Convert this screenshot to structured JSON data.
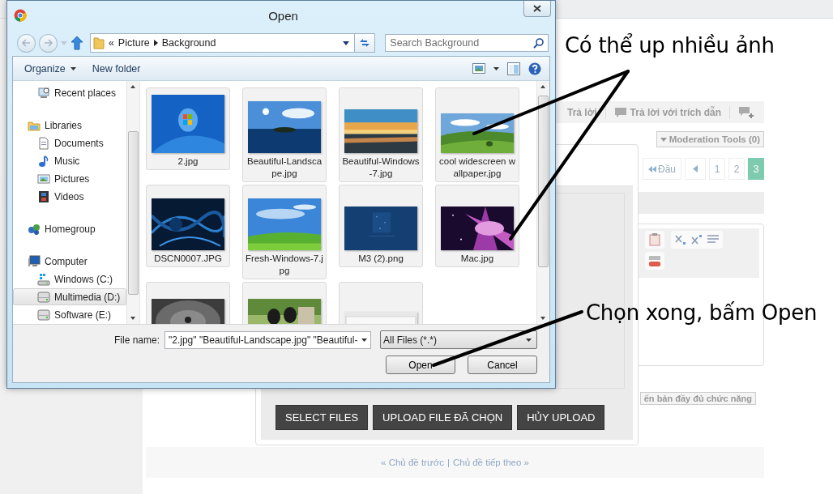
{
  "page": {
    "actions": [
      "Trả lời",
      "Trả lời với trích dẫn"
    ],
    "moderation": "Moderation Tools (0)",
    "pagination": {
      "first": "Đầu",
      "pages": [
        {
          "label": "1",
          "selected": false
        },
        {
          "label": "2",
          "selected": false
        },
        {
          "label": "3",
          "selected": true
        }
      ]
    },
    "editor_link": "ến bản đầy đủ chức năng",
    "upload_buttons": [
      "SELECT FILES",
      "UPLOAD FILE ĐÃ CHỌN",
      "HỦY UPLOAD"
    ],
    "footer": {
      "prev": "« Chủ đề trước",
      "separator": "|",
      "next": "Chủ đề tiếp theo »"
    }
  },
  "dialog": {
    "title": "Open",
    "breadcrumb": {
      "overflow": "«",
      "items": [
        "Picture",
        "Background"
      ]
    },
    "search": {
      "placeholder": "Search Background"
    },
    "toolbar": [
      {
        "label": "Organize",
        "kind": "menu"
      },
      {
        "label": "New folder",
        "kind": "plain"
      }
    ],
    "nav": [
      {
        "children": [
          {
            "label": "Recent places",
            "kind": "recent",
            "selected": false
          }
        ]
      },
      {
        "label": "Libraries",
        "kind": "library",
        "children": [
          {
            "label": "Documents",
            "kind": "documents",
            "selected": false
          },
          {
            "label": "Music",
            "kind": "music",
            "selected": false
          },
          {
            "label": "Pictures",
            "kind": "pictures",
            "selected": false
          },
          {
            "label": "Videos",
            "kind": "videos",
            "selected": false
          }
        ]
      },
      {
        "label": "Homegroup",
        "kind": "homegroup"
      },
      {
        "label": "Computer",
        "kind": "computer",
        "children": [
          {
            "label": "Windows (C:)",
            "kind": "system-drive",
            "selected": false
          },
          {
            "label": "Multimedia (D:)",
            "kind": "drive",
            "selected": true
          },
          {
            "label": "Software (E:)",
            "kind": "drive",
            "selected": false
          }
        ]
      }
    ],
    "files": [
      {
        "name": "2.jpg",
        "selected": true
      },
      {
        "name": "Beautiful-Landscape.jpg",
        "selected": true
      },
      {
        "name": "Beautiful-Windows-7.jpg",
        "selected": true
      },
      {
        "name": "cool widescreen wallpaper.jpg",
        "selected": true
      },
      {
        "name": "DSCN0007.JPG",
        "selected": true
      },
      {
        "name": "Fresh-Windows-7.jpg",
        "selected": true
      },
      {
        "name": "M3 (2).png",
        "selected": true
      },
      {
        "name": "Mac.jpg",
        "selected": true
      },
      {
        "selected": true
      },
      {
        "selected": true
      },
      {
        "selected": true
      }
    ],
    "file_name": {
      "label": "File name:",
      "value": "\"2.jpg\" \"Beautiful-Landscape.jpg\" \"Beautiful-"
    },
    "filter": "All Files (*.*)",
    "buttons": [
      "Open",
      "Cancel"
    ]
  },
  "annotations": [
    {
      "text": "Có thể up nhiều ảnh"
    },
    {
      "text": "Chọn xong, bấm Open"
    }
  ]
}
